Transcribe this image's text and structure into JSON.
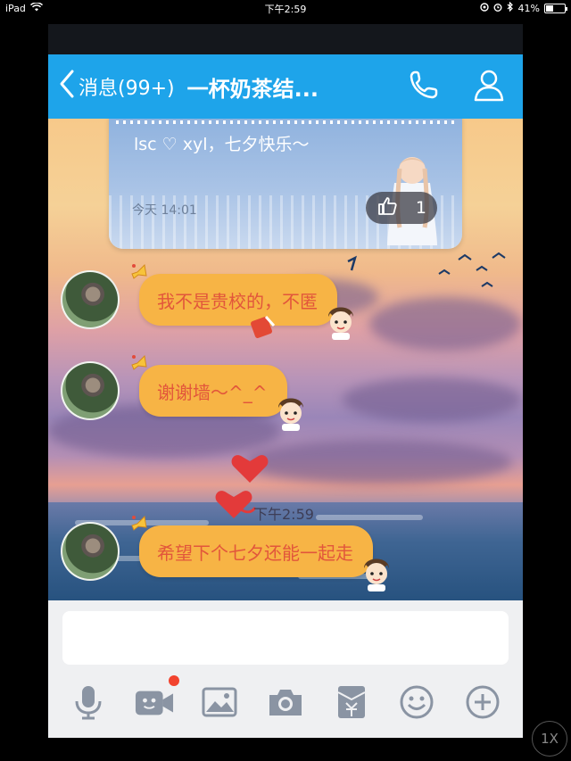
{
  "status_bar": {
    "device": "iPad",
    "time": "下午2:59",
    "battery": "41%",
    "battery_level": 0.41
  },
  "navbar": {
    "back_label": "消息(99+)",
    "title": "一杯奶茶结...",
    "icons": [
      "phone-icon",
      "profile-icon"
    ],
    "accent_color": "#1ea4ea"
  },
  "top_card": {
    "text": "lsc ♡ xyl，七夕快乐～",
    "time": "今天 14:01",
    "like_count": "1"
  },
  "messages": [
    {
      "text": "我不是贵校的，不匿"
    },
    {
      "text": "谢谢墙～^_^"
    },
    {
      "text": "希望下个七夕还能一起走"
    }
  ],
  "divider_time": "下午2:59",
  "input": {
    "placeholder": ""
  },
  "toolbar": {
    "icons": [
      "microphone-icon",
      "video-icon",
      "image-icon",
      "camera-icon",
      "red-packet-icon",
      "emoji-icon",
      "plus-icon"
    ]
  },
  "zoom": "1X"
}
